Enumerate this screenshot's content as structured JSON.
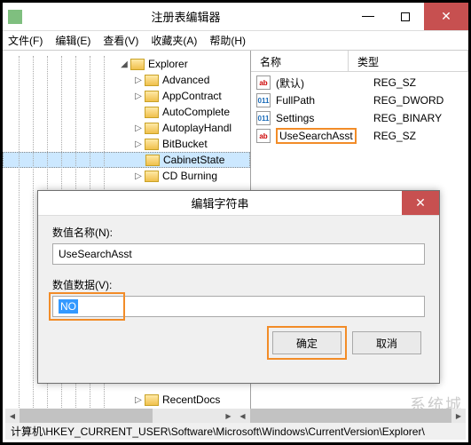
{
  "window": {
    "title": "注册表编辑器",
    "menu": {
      "file": "文件(F)",
      "edit": "编辑(E)",
      "view": "查看(V)",
      "favorites": "收藏夹(A)",
      "help": "帮助(H)"
    }
  },
  "tree": {
    "root": "Explorer",
    "items": [
      {
        "label": "Advanced",
        "expander": "▷"
      },
      {
        "label": "AppContract",
        "expander": "▷"
      },
      {
        "label": "AutoComplete",
        "expander": ""
      },
      {
        "label": "AutoplayHandl",
        "expander": "▷"
      },
      {
        "label": "BitBucket",
        "expander": "▷"
      },
      {
        "label": "CabinetState",
        "expander": "",
        "selected": true
      },
      {
        "label": "CD Burning",
        "expander": "▷"
      }
    ],
    "tail": {
      "label": "RecentDocs",
      "expander": "▷"
    }
  },
  "list": {
    "cols": {
      "name": "名称",
      "type": "类型"
    },
    "rows": [
      {
        "icon": "ab",
        "cls": "str",
        "name": "(默认)",
        "type": "REG_SZ"
      },
      {
        "icon": "011",
        "cls": "bin",
        "name": "FullPath",
        "type": "REG_DWORD"
      },
      {
        "icon": "011",
        "cls": "bin",
        "name": "Settings",
        "type": "REG_BINARY"
      },
      {
        "icon": "ab",
        "cls": "str",
        "name": "UseSearchAsst",
        "type": "REG_SZ",
        "highlight": true
      }
    ]
  },
  "dialog": {
    "title": "编辑字符串",
    "name_label": "数值名称(N):",
    "name_value": "UseSearchAsst",
    "data_label": "数值数据(V):",
    "data_value": "NO",
    "ok": "确定",
    "cancel": "取消"
  },
  "statusbar": "计算机\\HKEY_CURRENT_USER\\Software\\Microsoft\\Windows\\CurrentVersion\\Explorer\\",
  "watermark": "系统城"
}
